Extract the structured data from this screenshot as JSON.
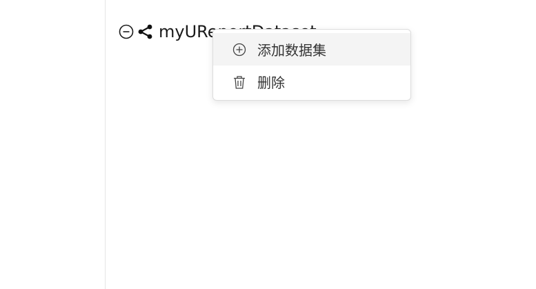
{
  "tree": {
    "node_label": "myUReportDataset",
    "collapse_icon": "minus-circle-icon",
    "node_icon": "share-icon"
  },
  "context_menu": {
    "items": [
      {
        "label": "添加数据集",
        "icon": "plus-circle-icon"
      },
      {
        "label": "删除",
        "icon": "trash-icon"
      }
    ]
  },
  "colors": {
    "text": "#1a1a1a",
    "menu_text": "#333333",
    "menu_hover_bg": "#f4f4f4",
    "divider": "#e4e4e4"
  }
}
